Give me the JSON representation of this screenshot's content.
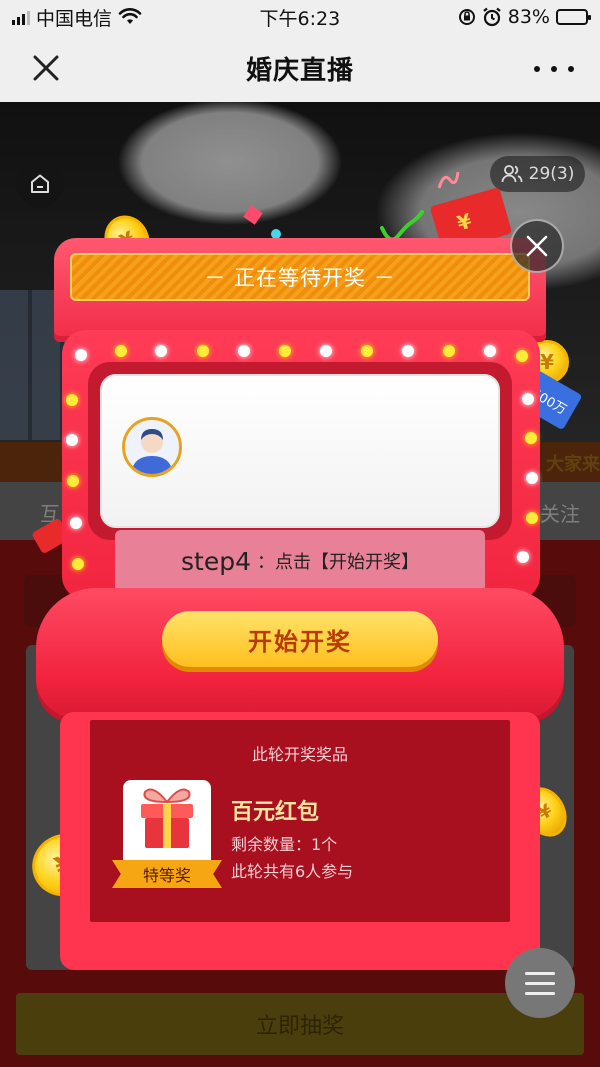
{
  "status_bar": {
    "carrier": "中国电信",
    "time": "下午6:23",
    "battery": "83%",
    "battery_level": 0.83
  },
  "nav": {
    "title": "婚庆直播"
  },
  "room": {
    "viewers": "29(3)",
    "behind_strip_text": "大家来",
    "behind_tab_left": "互",
    "behind_tab_right": "关注",
    "behind_button": "立即抽奖"
  },
  "lottery": {
    "banner": "－ 正在等待开奖 －",
    "tooltip_step": "step4",
    "tooltip_text": "：点击【开始开奖】",
    "start_button": "开始开奖",
    "prize_heading": "此轮开奖奖品",
    "prize_tier": "特等奖",
    "prize_name": "百元红包",
    "prize_remaining": "剩余数量：1个",
    "participants": "此轮共有6人参与",
    "tag_500": "500万"
  },
  "colors": {
    "machine_red": "#f2253f",
    "banner_orange": "#f5a11b",
    "button_gold": "#ffbf1e",
    "prize_bg": "#a80f1f"
  }
}
